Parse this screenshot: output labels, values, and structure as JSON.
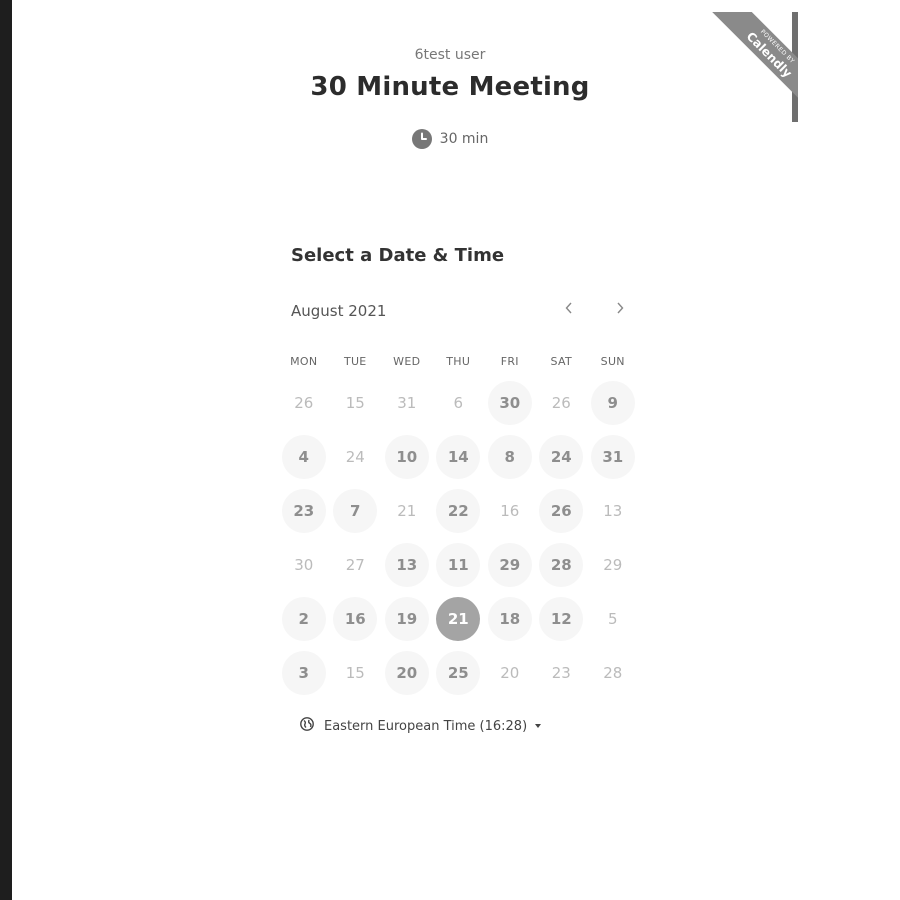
{
  "branding": {
    "powered_by": "POWERED BY",
    "name": "Calendly"
  },
  "event": {
    "host": "6test user",
    "title": "30 Minute Meeting",
    "duration": "30 min"
  },
  "scheduler": {
    "heading": "Select a Date & Time",
    "month_label": "August 2021",
    "prev_icon": "chevron-left-icon",
    "next_icon": "chevron-right-icon",
    "weekdays": [
      "MON",
      "TUE",
      "WED",
      "THU",
      "FRI",
      "SAT",
      "SUN"
    ],
    "weeks": [
      [
        {
          "d": "26",
          "s": "disabled"
        },
        {
          "d": "15",
          "s": "disabled"
        },
        {
          "d": "31",
          "s": "disabled"
        },
        {
          "d": "6",
          "s": "disabled"
        },
        {
          "d": "30",
          "s": "available"
        },
        {
          "d": "26",
          "s": "disabled"
        },
        {
          "d": "9",
          "s": "available"
        }
      ],
      [
        {
          "d": "4",
          "s": "available"
        },
        {
          "d": "24",
          "s": "disabled"
        },
        {
          "d": "10",
          "s": "available"
        },
        {
          "d": "14",
          "s": "available"
        },
        {
          "d": "8",
          "s": "available"
        },
        {
          "d": "24",
          "s": "available"
        },
        {
          "d": "31",
          "s": "available"
        }
      ],
      [
        {
          "d": "23",
          "s": "available"
        },
        {
          "d": "7",
          "s": "available"
        },
        {
          "d": "21",
          "s": "disabled"
        },
        {
          "d": "22",
          "s": "available"
        },
        {
          "d": "16",
          "s": "disabled"
        },
        {
          "d": "26",
          "s": "available"
        },
        {
          "d": "13",
          "s": "disabled"
        }
      ],
      [
        {
          "d": "30",
          "s": "disabled"
        },
        {
          "d": "27",
          "s": "disabled"
        },
        {
          "d": "13",
          "s": "available"
        },
        {
          "d": "11",
          "s": "available"
        },
        {
          "d": "29",
          "s": "available"
        },
        {
          "d": "28",
          "s": "available"
        },
        {
          "d": "29",
          "s": "disabled"
        }
      ],
      [
        {
          "d": "2",
          "s": "available"
        },
        {
          "d": "16",
          "s": "available"
        },
        {
          "d": "19",
          "s": "available"
        },
        {
          "d": "21",
          "s": "selected"
        },
        {
          "d": "18",
          "s": "available"
        },
        {
          "d": "12",
          "s": "available"
        },
        {
          "d": "5",
          "s": "disabled"
        }
      ],
      [
        {
          "d": "3",
          "s": "available"
        },
        {
          "d": "15",
          "s": "disabled"
        },
        {
          "d": "20",
          "s": "available"
        },
        {
          "d": "25",
          "s": "available"
        },
        {
          "d": "20",
          "s": "disabled"
        },
        {
          "d": "23",
          "s": "disabled"
        },
        {
          "d": "28",
          "s": "disabled"
        }
      ]
    ],
    "timezone": {
      "icon": "globe-icon",
      "label": "Eastern European Time (16:28)"
    }
  },
  "colors": {
    "selected": "#a4a4a4",
    "available_bg": "#f6f6f6",
    "ribbon": "#8a8a8a"
  }
}
